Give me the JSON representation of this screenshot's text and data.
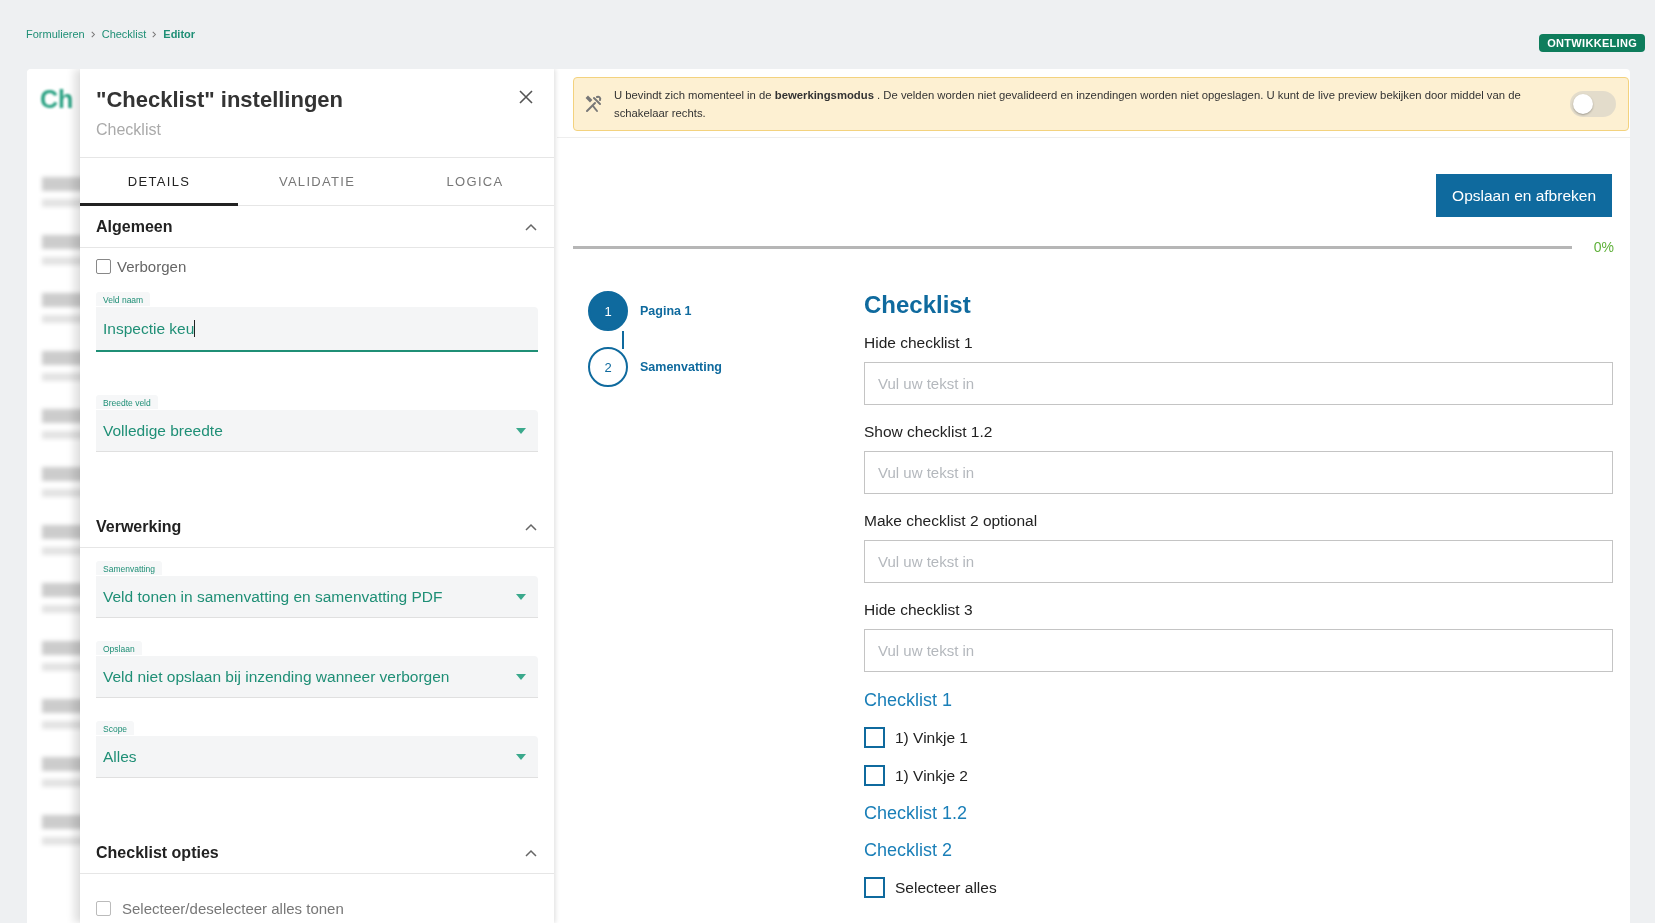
{
  "breadcrumb": [
    {
      "label": "Formulieren",
      "current": false
    },
    {
      "label": "Checklist",
      "current": false
    },
    {
      "label": "Editor",
      "current": true
    }
  ],
  "environment_badge": "ONTWIKKELING",
  "background_page": {
    "title": "Ch"
  },
  "settings_panel": {
    "title": "\"Checklist\" instellingen",
    "subtitle": "Checklist",
    "tabs": [
      {
        "label": "DETAILS",
        "selected": true
      },
      {
        "label": "VALIDATIE",
        "selected": false
      },
      {
        "label": "LOGICA",
        "selected": false
      }
    ],
    "sections": [
      {
        "title": "Algemeen",
        "expanded": true,
        "fields": [
          {
            "kind": "checkbox",
            "label": "Verborgen",
            "checked": false
          },
          {
            "kind": "text",
            "label": "Veld naam",
            "value": "Inspectie keu"
          },
          {
            "kind": "select",
            "label": "Breedte veld",
            "value": "Volledige breedte"
          }
        ]
      },
      {
        "title": "Verwerking",
        "expanded": true,
        "fields": [
          {
            "kind": "select",
            "label": "Samenvatting",
            "value": "Veld tonen in samenvatting en samenvatting PDF"
          },
          {
            "kind": "select",
            "label": "Opslaan",
            "value": "Veld niet opslaan bij inzending wanneer verborgen"
          },
          {
            "kind": "select",
            "label": "Scope",
            "value": "Alles"
          }
        ]
      },
      {
        "title": "Checklist opties",
        "expanded": true,
        "fields": [
          {
            "kind": "checkbox",
            "label": "Selecteer/deselecteer alles tonen",
            "checked": false
          }
        ]
      }
    ]
  },
  "preview": {
    "notice": {
      "text": "U bevindt zich momenteel in de **bewerkingsmodus** . De velden worden niet gevalideerd en inzendingen worden niet opgeslagen. U kunt de live preview bekijken door middel van de schakelaar rechts.",
      "toggle_on": false
    },
    "save_button": "Opslaan en afbreken",
    "progress": {
      "level": 0,
      "reading": "0%"
    },
    "steps": [
      {
        "number": "1",
        "label": "Pagina 1",
        "selected": true
      },
      {
        "number": "2",
        "label": "Samenvatting",
        "selected": false
      }
    ],
    "form": {
      "title": "Checklist",
      "items": [
        {
          "kind": "input",
          "label": "Hide checklist 1",
          "placeholder": "Vul uw tekst in"
        },
        {
          "kind": "input",
          "label": "Show checklist 1.2",
          "placeholder": "Vul uw tekst in"
        },
        {
          "kind": "input",
          "label": "Make checklist 2 optional",
          "placeholder": "Vul uw tekst in"
        },
        {
          "kind": "input",
          "label": "Hide checklist 3",
          "placeholder": "Vul uw tekst in"
        },
        {
          "kind": "heading",
          "text": "Checklist 1"
        },
        {
          "kind": "checkbox",
          "label": "1) Vinkje 1",
          "checked": false
        },
        {
          "kind": "checkbox",
          "label": "1) Vinkje 2",
          "checked": false
        },
        {
          "kind": "heading",
          "text": "Checklist 1.2"
        },
        {
          "kind": "heading",
          "text": "Checklist 2"
        },
        {
          "kind": "checkbox",
          "label": "Selecteer alles",
          "checked": false
        }
      ]
    }
  }
}
